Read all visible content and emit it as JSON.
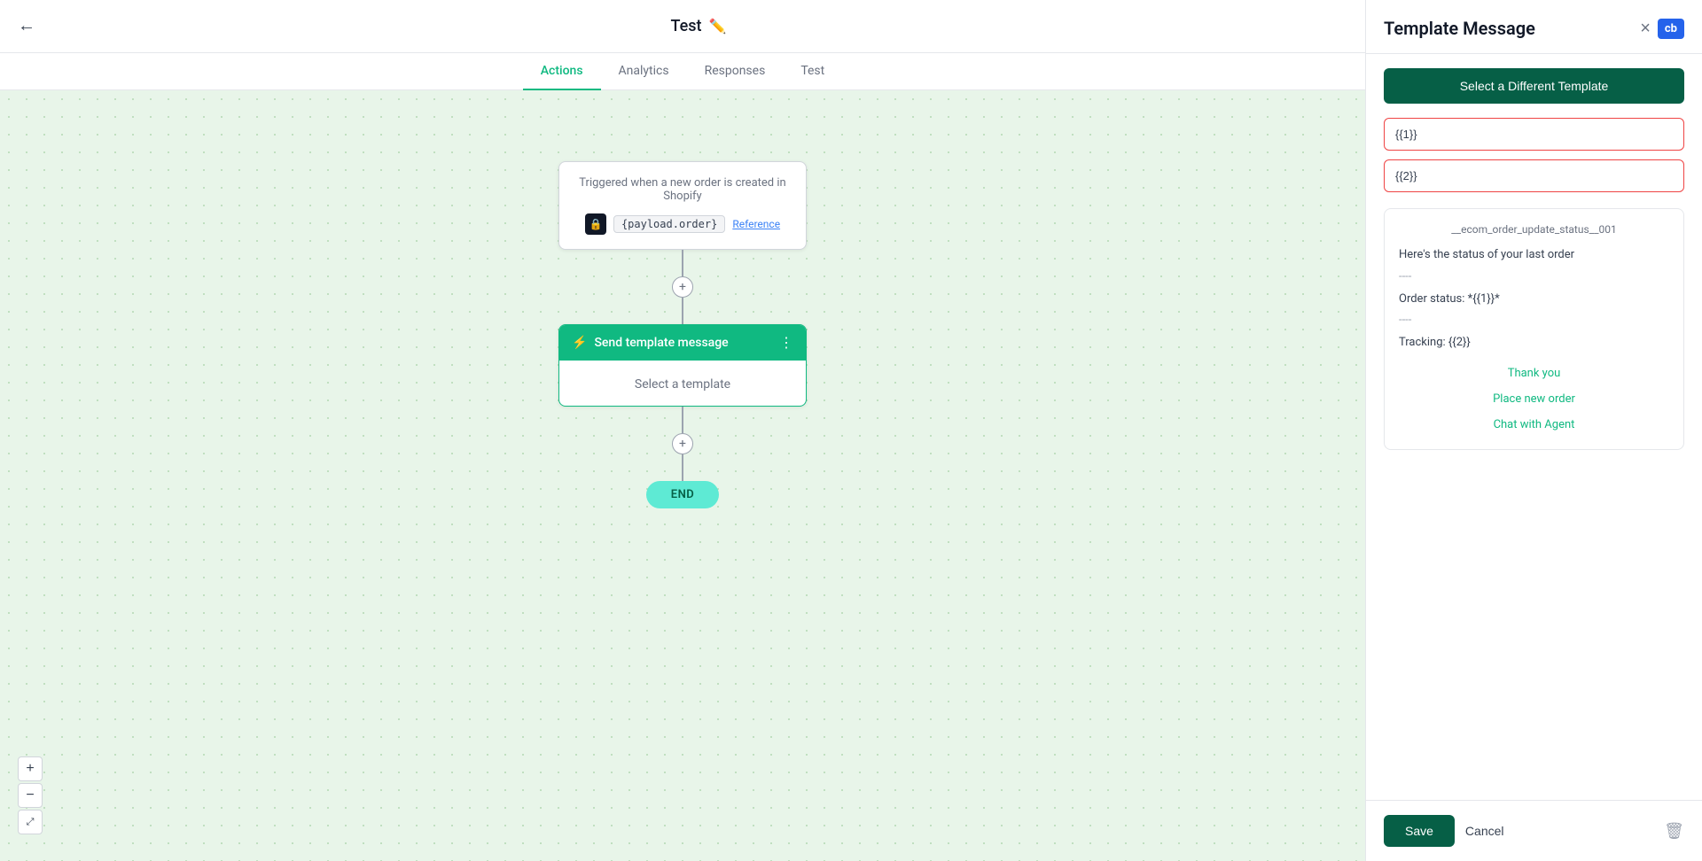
{
  "header": {
    "back_label": "←",
    "title": "Test",
    "edit_icon": "✏️"
  },
  "tabs": [
    {
      "label": "Actions",
      "active": true
    },
    {
      "label": "Analytics",
      "active": false
    },
    {
      "label": "Responses",
      "active": false
    },
    {
      "label": "Test",
      "active": false
    }
  ],
  "canvas": {
    "trigger_text": "Triggered when a new order is created in Shopify",
    "payload_badge": "{payload.order}",
    "reference_label": "Reference",
    "action_node_title": "Send template message",
    "select_template_text": "Select a template",
    "end_label": "END"
  },
  "zoom": {
    "plus": "+",
    "minus": "−",
    "fit": "⤢"
  },
  "panel": {
    "title": "Template Message",
    "close_icon": "×",
    "cb_logo": "cb",
    "select_different_btn": "Select a Different Template",
    "input1_value": "{{1}}",
    "input2_value": "{{2}}",
    "template_name": "__ecom_order_update_status__001",
    "template_body_line1": "Here's the status of your last order",
    "template_body_divider1": "----",
    "template_body_line2": "Order status: *{{1}}*",
    "template_body_divider2": "----",
    "template_body_line3": "Tracking: {{2}}",
    "action_btn1": "Thank you",
    "action_btn2": "Place new order",
    "action_btn3": "Chat with Agent",
    "save_label": "Save",
    "cancel_label": "Cancel",
    "delete_icon": "🗑"
  }
}
